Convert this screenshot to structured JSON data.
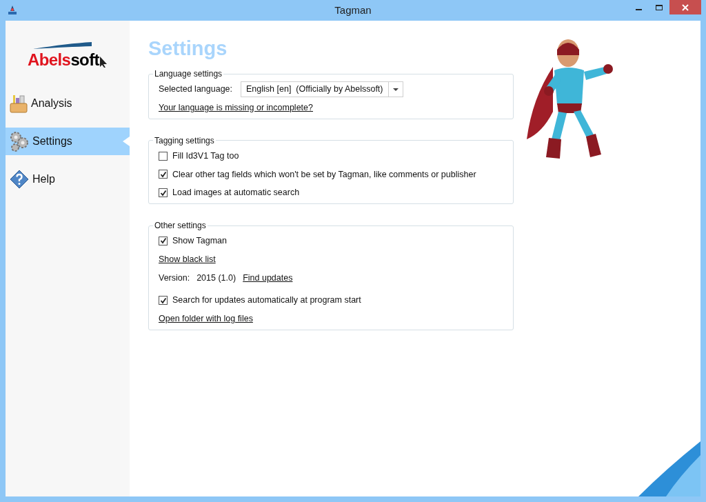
{
  "window": {
    "title": "Tagman"
  },
  "logo": {
    "text_red": "Abels",
    "text_dark": "soft"
  },
  "sidebar": {
    "items": [
      {
        "label": "Analysis",
        "kind": "analysis",
        "selected": false
      },
      {
        "label": "Settings",
        "kind": "settings",
        "selected": true
      },
      {
        "label": "Help",
        "kind": "help",
        "selected": false
      }
    ]
  },
  "page_title": "Settings",
  "groups": [
    {
      "title": "Language settings",
      "items": [
        {
          "kind": "dropdown",
          "label": "Selected language:",
          "value": "English [en]  (Officially by Abelssoft)"
        },
        {
          "kind": "link",
          "label": "Your language is missing or incomplete?"
        }
      ]
    },
    {
      "title": "Tagging settings",
      "items": [
        {
          "kind": "checkbox",
          "label": "Fill Id3V1 Tag too",
          "checked": false
        },
        {
          "kind": "checkbox",
          "label": "Clear other tag fields which won't be set by Tagman, like comments or publisher",
          "checked": true
        },
        {
          "kind": "checkbox",
          "label": "Load images at automatic search",
          "checked": true
        }
      ]
    },
    {
      "title": "Other settings",
      "items": [
        {
          "kind": "checkbox",
          "label": "Show Tagman",
          "checked": true
        },
        {
          "kind": "link",
          "label": "Show black list"
        },
        {
          "kind": "version",
          "label": "Version:",
          "value": "2015 (1.0)",
          "link": "Find updates"
        },
        {
          "kind": "checkbox",
          "label": "Search for updates automatically at program start",
          "checked": true
        },
        {
          "kind": "link",
          "label": "Open folder with log files"
        }
      ]
    }
  ]
}
